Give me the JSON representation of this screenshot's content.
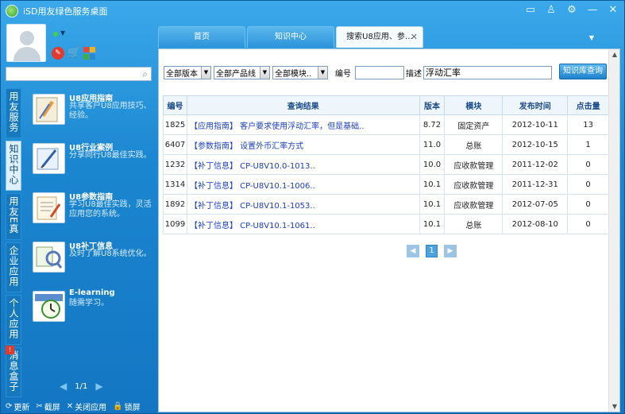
{
  "window": {
    "title": "iSD用友绿色服务桌面"
  },
  "sidebar": {
    "search": {
      "value": "",
      "placeholder": ""
    },
    "vtabs": [
      {
        "label": "用友服务",
        "active": false
      },
      {
        "label": "知识中心",
        "active": true
      },
      {
        "label": "用友E真",
        "active": false
      },
      {
        "label": "企业应用",
        "active": false
      },
      {
        "label": "个人应用",
        "active": false
      },
      {
        "label": "消息盒子",
        "active": false,
        "badge": "!"
      }
    ],
    "feeds": [
      {
        "title": "U8应用指南",
        "desc": "共享客户U8应用技巧、经验。"
      },
      {
        "title": "U8行业案例",
        "desc": "分享同行U8最佳实践。"
      },
      {
        "title": "U8参数指南",
        "desc": "学习U8最佳实践，灵活应用您的系统。"
      },
      {
        "title": "U8补丁信息",
        "desc": "及时了解U8系统优化。"
      },
      {
        "title": "E-learning",
        "desc": "随需学习。"
      }
    ],
    "pager": {
      "text": "1/1"
    },
    "bottom": {
      "refresh": "更新",
      "screenshot": "截屏",
      "close_apps": "关闭应用",
      "lock": "锁屏"
    }
  },
  "tabs": [
    {
      "label": "首页"
    },
    {
      "label": "知识中心"
    },
    {
      "label": "搜索U8应用、参…"
    }
  ],
  "filters": {
    "version": "全部版本",
    "product_line": "全部产品线",
    "module": "全部模块..",
    "id_label": "编号",
    "id_value": "",
    "desc_label": "描述",
    "desc_value": "浮动汇率",
    "search_button": "知识库查询"
  },
  "table": {
    "headers": [
      "编号",
      "查询结果",
      "版本",
      "模块",
      "发布时间",
      "点击量"
    ],
    "rows": [
      {
        "id": "1825",
        "title": "【应用指南】 客户要求使用浮动汇率，但是基础..",
        "version": "8.72",
        "module": "固定资产",
        "date": "2012-10-11",
        "clicks": "13"
      },
      {
        "id": "6407",
        "title": "【参数指南】 设置外币汇率方式",
        "version": "11.0",
        "module": "总账",
        "date": "2012-10-15",
        "clicks": "1"
      },
      {
        "id": "1232",
        "title": "【补丁信息】 CP-U8V10.0-1013..",
        "version": "10.0",
        "module": "应收款管理",
        "date": "2011-12-02",
        "clicks": "0"
      },
      {
        "id": "1314",
        "title": "【补丁信息】 CP-U8V10.1-1006..",
        "version": "10.1",
        "module": "应收款管理",
        "date": "2011-12-31",
        "clicks": "0"
      },
      {
        "id": "1892",
        "title": "【补丁信息】 CP-U8V10.1-1053..",
        "version": "10.1",
        "module": "应收款管理",
        "date": "2012-07-05",
        "clicks": "0"
      },
      {
        "id": "1099",
        "title": "【补丁信息】 CP-U8V10.1-1061..",
        "version": "10.1",
        "module": "总账",
        "date": "2012-08-10",
        "clicks": "0"
      }
    ]
  },
  "pager": {
    "page": "1"
  }
}
